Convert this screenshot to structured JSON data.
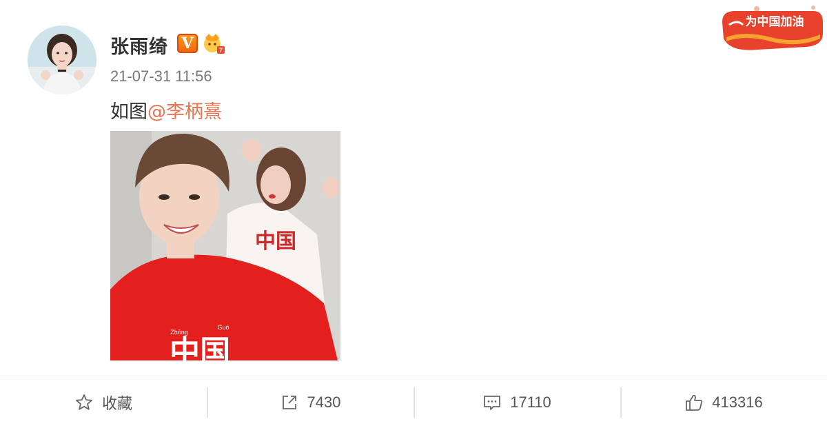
{
  "post": {
    "author": "张雨绮",
    "verified_badge": "V",
    "timestamp": "21-07-31 11:56",
    "text_prefix": "如图",
    "mention": "@李柄熹",
    "photo_print_text_pinyin_left": "Zhōng",
    "photo_print_text_pinyin_right": "Guó",
    "photo_print_text": "中国"
  },
  "campaign_badge": {
    "text": "为中国加油"
  },
  "actions": {
    "favorite_label": "收藏",
    "repost_count": "7430",
    "comment_count": "17110",
    "like_count": "413316"
  },
  "colors": {
    "mention": "#eb7350",
    "username": "#333333",
    "timestamp": "#777777",
    "badge_orange": "#f0650a",
    "campaign_red": "#e8412c"
  },
  "icons": [
    "verified-v-icon",
    "crown-icon",
    "star-icon",
    "share-icon",
    "comment-icon",
    "thumbs-up-icon"
  ]
}
